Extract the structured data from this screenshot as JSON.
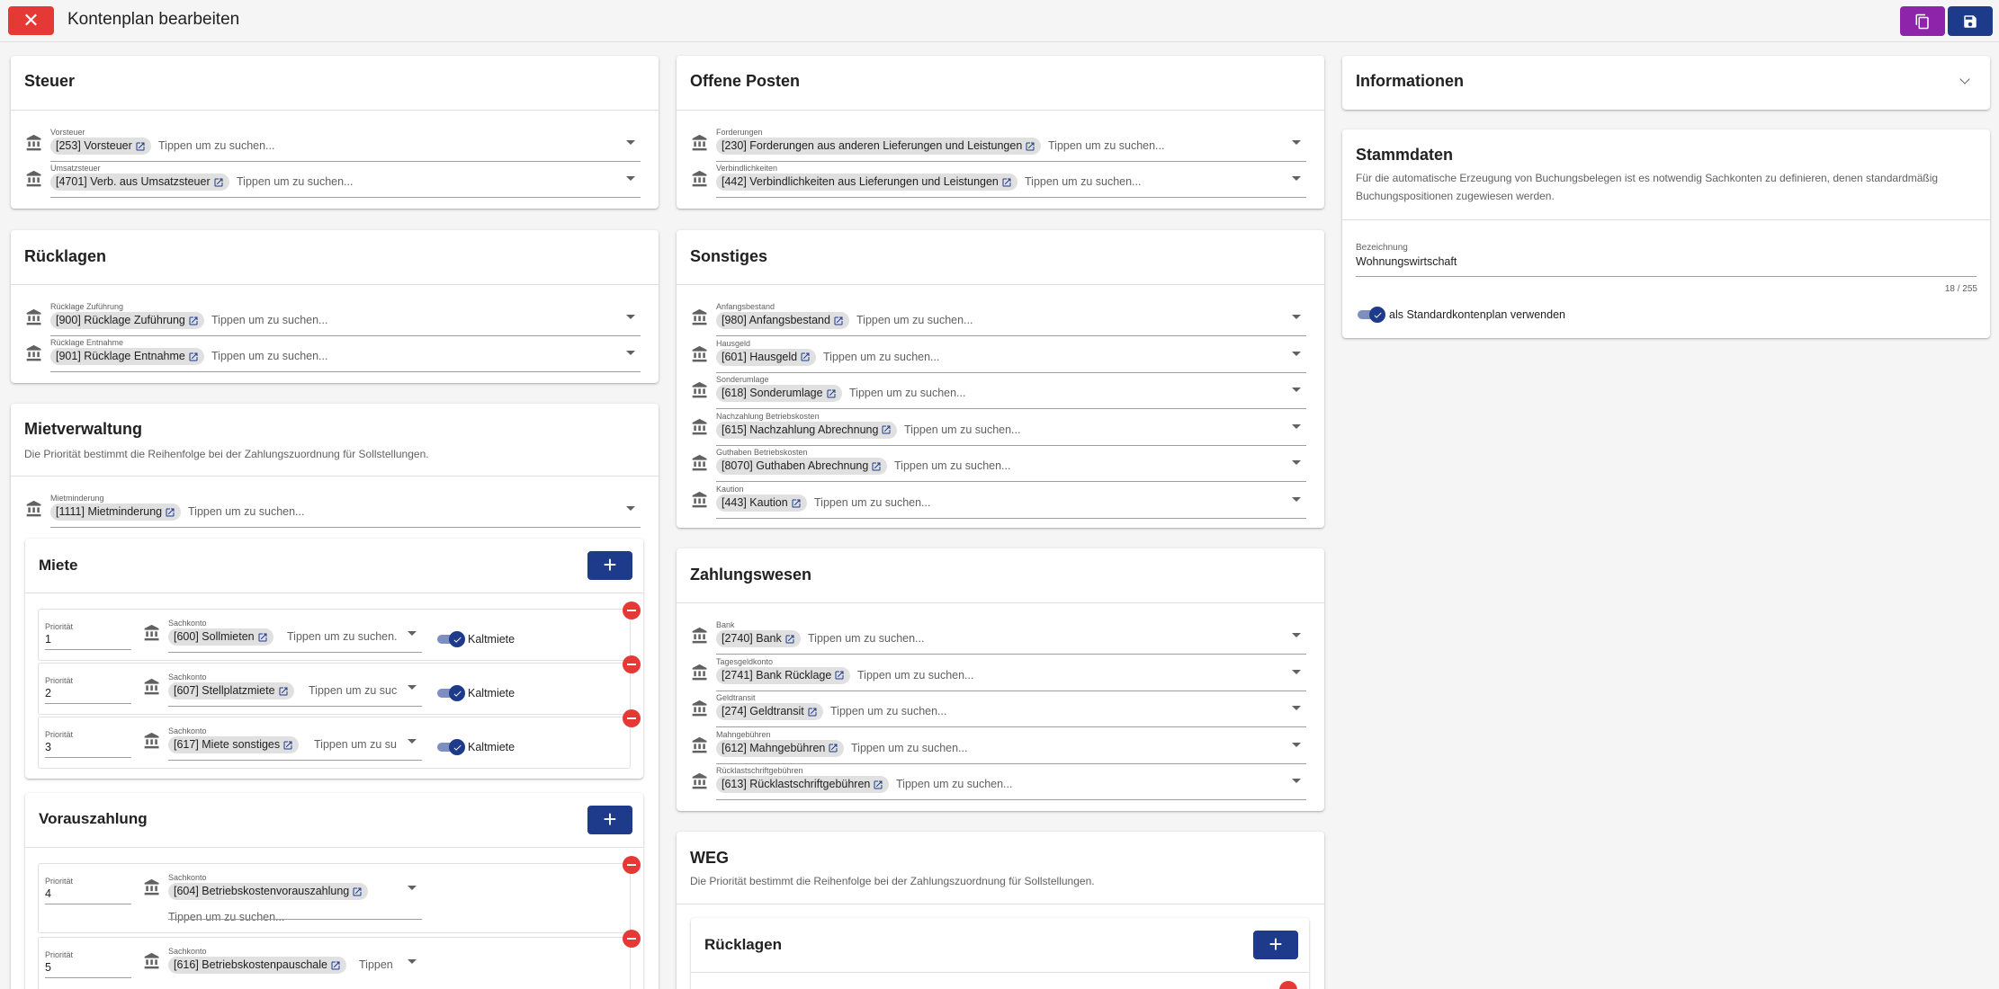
{
  "header": {
    "title": "Kontenplan bearbeiten",
    "close_icon": "close-icon",
    "copy_icon": "copy-icon",
    "save_icon": "save-icon"
  },
  "placeholder": "Tippen um zu suchen...",
  "steuer": {
    "title": "Steuer",
    "rows": [
      {
        "label": "Vorsteuer",
        "value": "[253] Vorsteuer"
      },
      {
        "label": "Umsatzsteuer",
        "value": "[4701] Verb. aus Umsatzsteuer"
      }
    ]
  },
  "ruecklagen": {
    "title": "Rücklagen",
    "rows": [
      {
        "label": "Rücklage Zuführung",
        "value": "[900] Rücklage Zuführung"
      },
      {
        "label": "Rücklage Entnahme",
        "value": "[901] Rücklage Entnahme"
      }
    ]
  },
  "mietverwaltung": {
    "title": "Mietverwaltung",
    "description": "Die Priorität bestimmt die Reihenfolge bei der Zahlungszuordnung für Sollstellungen.",
    "rows": [
      {
        "label": "Mietminderung",
        "value": "[1111] Mietminderung"
      }
    ],
    "miete": {
      "title": "Miete",
      "add_icon": "plus-icon",
      "items": [
        {
          "prio_label": "Priorität",
          "prio": "1",
          "acct_label": "Sachkonto",
          "value": "[600] Sollmieten",
          "placeholder": "Tippen um zu suchen.",
          "toggle_label": "Kaltmiete",
          "toggle_on": true
        },
        {
          "prio_label": "Priorität",
          "prio": "2",
          "acct_label": "Sachkonto",
          "value": "[607] Stellplatzmiete",
          "placeholder": "Tippen um zu suc",
          "toggle_label": "Kaltmiete",
          "toggle_on": true
        },
        {
          "prio_label": "Priorität",
          "prio": "3",
          "acct_label": "Sachkonto",
          "value": "[617] Miete sonstiges",
          "placeholder": "Tippen um zu su",
          "toggle_label": "Kaltmiete",
          "toggle_on": true
        }
      ]
    },
    "vorauszahlung": {
      "title": "Vorauszahlung",
      "add_icon": "plus-icon",
      "items": [
        {
          "prio_label": "Priorität",
          "prio": "4",
          "acct_label": "Sachkonto",
          "value": "[604] Betriebskostenvorauszahlung",
          "placeholder": "Tippen um zu suchen..."
        },
        {
          "prio_label": "Priorität",
          "prio": "5",
          "acct_label": "Sachkonto",
          "value": "[616] Betriebskostenpauschale",
          "placeholder": "Tippen"
        }
      ]
    }
  },
  "offene_posten": {
    "title": "Offene Posten",
    "rows": [
      {
        "label": "Forderungen",
        "value": "[230] Forderungen aus anderen Lieferungen und Leistungen"
      },
      {
        "label": "Verbindlichkeiten",
        "value": "[442] Verbindlichkeiten aus Lieferungen und Leistungen"
      }
    ]
  },
  "sonstiges": {
    "title": "Sonstiges",
    "rows": [
      {
        "label": "Anfangsbestand",
        "value": "[980] Anfangsbestand"
      },
      {
        "label": "Hausgeld",
        "value": "[601] Hausgeld"
      },
      {
        "label": "Sonderumlage",
        "value": "[618] Sonderumlage"
      },
      {
        "label": "Nachzahlung Betriebskosten",
        "value": "[615] Nachzahlung Abrechnung"
      },
      {
        "label": "Guthaben Betriebskosten",
        "value": "[8070] Guthaben Abrechnung"
      },
      {
        "label": "Kaution",
        "value": "[443] Kaution"
      }
    ]
  },
  "zahlungswesen": {
    "title": "Zahlungswesen",
    "rows": [
      {
        "label": "Bank",
        "value": "[2740] Bank"
      },
      {
        "label": "Tagesgeldkonto",
        "value": "[2741] Bank Rücklage"
      },
      {
        "label": "Geldtransit",
        "value": "[274] Geldtransit"
      },
      {
        "label": "Mahngebühren",
        "value": "[612] Mahngebühren"
      },
      {
        "label": "Rücklastschriftgebühren",
        "value": "[613] Rücklastschriftgebühren"
      }
    ]
  },
  "weg": {
    "title": "WEG",
    "description": "Die Priorität bestimmt die Reihenfolge bei der Zahlungszuordnung für Sollstellungen.",
    "ruecklagen": {
      "title": "Rücklagen",
      "add_icon": "plus-icon"
    }
  },
  "informationen": {
    "title": "Informationen",
    "expand_icon": "chevron-down-icon"
  },
  "stammdaten": {
    "title": "Stammdaten",
    "description": "Für die automatische Erzeugung von Buchungsbelegen ist es notwendig Sachkonten zu definieren, denen standardmäßig Buchungspositionen zugewiesen werden.",
    "name_label": "Bezeichnung",
    "name_value": "Wohnungswirtschaft",
    "counter": "18 / 255",
    "default_toggle_label": "als Standardkontenplan verwenden",
    "default_toggle_on": true
  },
  "colors": {
    "danger": "#e53935",
    "primary": "#1e3a8a",
    "accent": "#8e24aa"
  }
}
